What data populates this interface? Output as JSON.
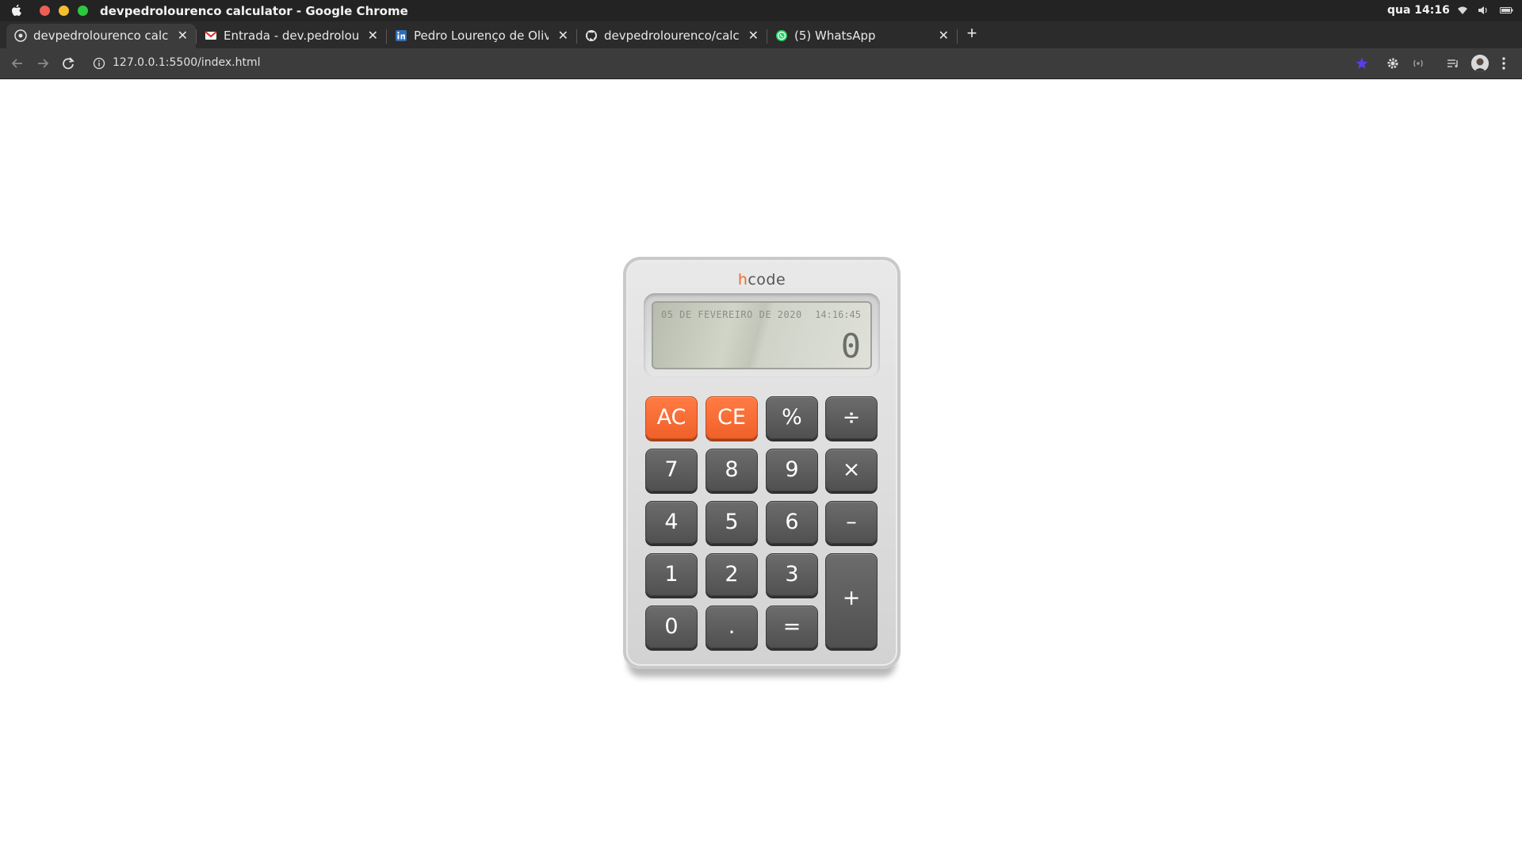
{
  "os_bar": {
    "title": "devpedrolourenco calculator - Google Chrome",
    "clock": "qua 14:16",
    "icons": [
      "apple-icon",
      "wifi-icon",
      "volume-icon",
      "battery-icon"
    ]
  },
  "tabs": [
    {
      "label": "devpedrolourenco calcula",
      "favicon": "page-icon",
      "active": true
    },
    {
      "label": "Entrada - dev.pedrolouren",
      "favicon": "gmail-icon",
      "active": false
    },
    {
      "label": "Pedro Lourenço de Oliveira",
      "favicon": "linkedin-icon",
      "active": false
    },
    {
      "label": "devpedrolourenco/calcula",
      "favicon": "github-icon",
      "active": false
    },
    {
      "label": "(5) WhatsApp",
      "favicon": "whatsapp-icon",
      "active": false
    }
  ],
  "toolbar": {
    "url": "127.0.0.1:5500/index.html",
    "icons": [
      "back-icon",
      "forward-icon",
      "reload-icon",
      "info-icon",
      "extension-star-icon",
      "extension-gear-icon",
      "extension-cast-icon",
      "media-list-icon",
      "profile-avatar",
      "menu-icon"
    ]
  },
  "calculator": {
    "brand_h": "h",
    "brand_rest": "code",
    "date": "05 DE FEVEREIRO DE 2020",
    "time": "14:16:45",
    "value": "0",
    "keys": {
      "ac": "AC",
      "ce": "CE",
      "percent": "%",
      "divide": "÷",
      "seven": "7",
      "eight": "8",
      "nine": "9",
      "multiply": "×",
      "four": "4",
      "five": "5",
      "six": "6",
      "subtract": "–",
      "one": "1",
      "two": "2",
      "three": "3",
      "add": "+",
      "zero": "0",
      "dot": ".",
      "equals": "="
    }
  },
  "colors": {
    "accent_orange": "#f26a32",
    "key_dark": "#555555",
    "display_bg": "#cfd3c6"
  }
}
